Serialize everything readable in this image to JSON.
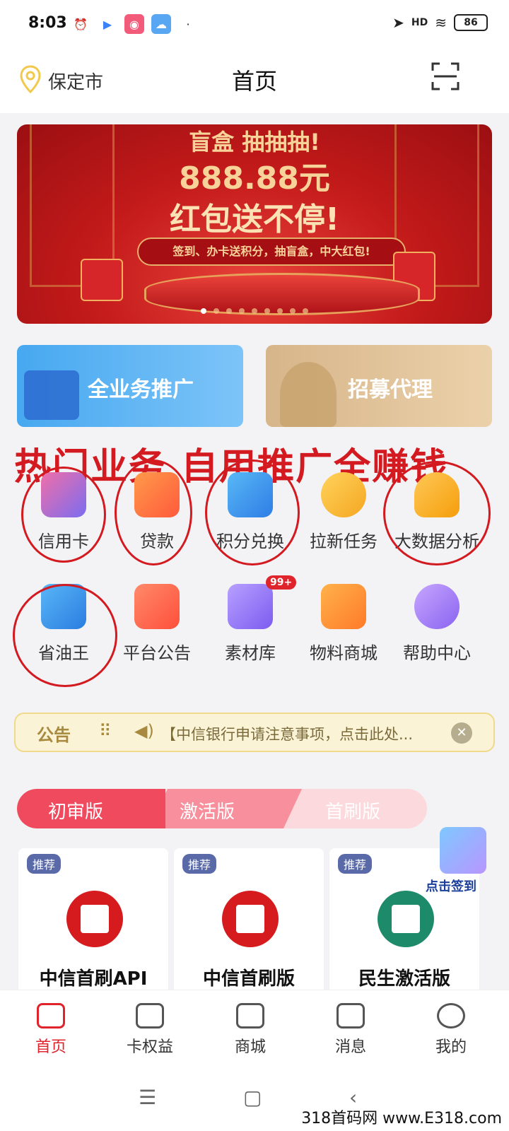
{
  "status": {
    "time": "8:03",
    "battery": "86",
    "network": "HD"
  },
  "header": {
    "city": "保定市",
    "title": "首页"
  },
  "banner": {
    "line1": "盲盒 抽抽抽!",
    "line2": "888.88元",
    "line3": "红包送不停!",
    "ribbon": "签到、办卡送积分，抽盲盒，中大红包!",
    "dot_count": 9,
    "active_dot": 0
  },
  "promo": {
    "left_label": "全业务推广",
    "right_label": "招募代理"
  },
  "slogan": "热门业务 自用推广全赚钱",
  "grid": {
    "row1": [
      "信用卡",
      "贷款",
      "积分兑换",
      "拉新任务",
      "大数据分析"
    ],
    "row2": [
      "省油王",
      "平台公告",
      "素材库",
      "物料商城",
      "帮助中心"
    ],
    "badge": "99+"
  },
  "notice": {
    "tag": "公告",
    "text": "【中信银行申请注意事项，点击此处...",
    "close": "✕"
  },
  "tabs": [
    "初审版",
    "激活版",
    "首刷版"
  ],
  "cards": [
    {
      "tag": "推荐",
      "name": "中信首刷API"
    },
    {
      "tag": "推荐",
      "name": "中信首刷版"
    },
    {
      "tag": "推荐",
      "name": "民生激活版"
    }
  ],
  "signin": "点击签到",
  "bottom_nav": [
    "首页",
    "卡权益",
    "商城",
    "消息",
    "我的"
  ],
  "sysnav": {
    "menu": "☰",
    "home": "▢",
    "back": "‹"
  },
  "watermark": "318首码网 www.E318.com",
  "colors": {
    "accent": "#e0242b",
    "banner_red": "#c31a1a",
    "tab_pink": "#f04a5f",
    "notice_bg": "#fbf3d6"
  }
}
